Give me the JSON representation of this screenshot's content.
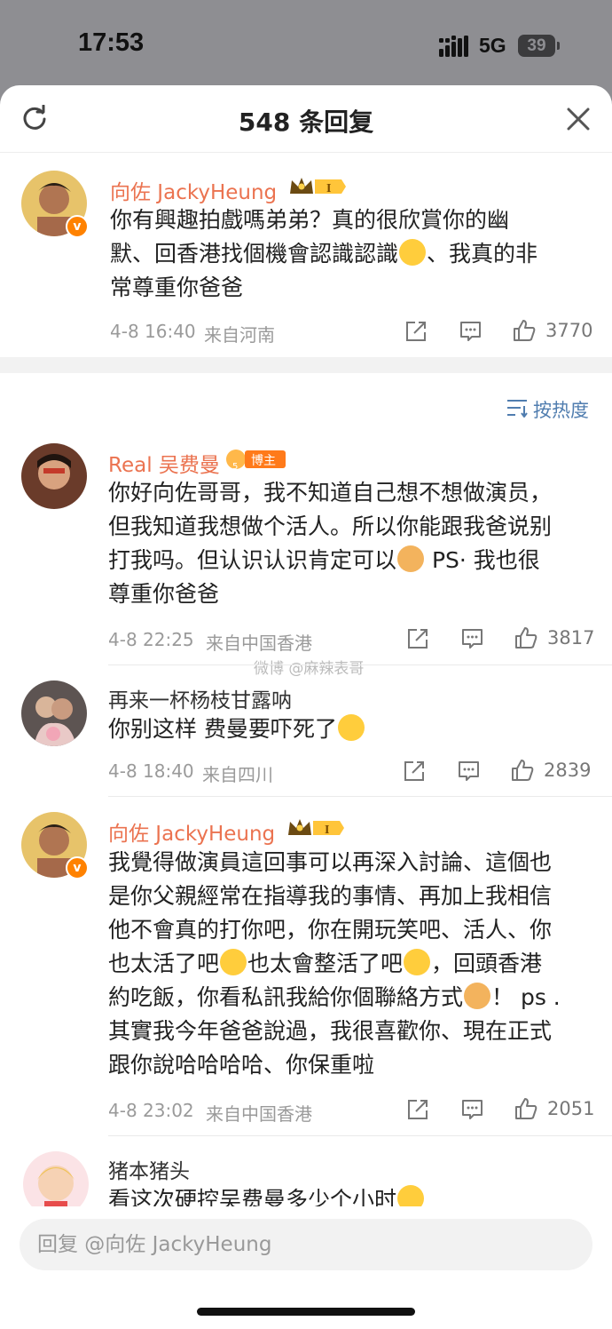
{
  "status_bar": {
    "time": "17:53",
    "network": "5G",
    "battery": "39"
  },
  "header": {
    "title": "548 条回复"
  },
  "root_comment": {
    "user": "向佐 JackyHeung",
    "badge": "I",
    "text": [
      "你有興趣拍戲嗎弟弟？真的很欣賞你的幽",
      "默、回香港找個機會認識認識",
      "、我真的非",
      "常尊重你爸爸"
    ],
    "time": "4-8 16:40",
    "location": "来自河南",
    "likes": "3770"
  },
  "sort_label": "按热度",
  "replies": [
    {
      "user": "Real 吴费曼",
      "badge": "博主",
      "level": "5",
      "text": [
        "你好向佐哥哥，我不知道自己想不想做演员，",
        "但我知道我想做个活人。所以你能跟我爸说别",
        "打我吗。但认识认识肯定可以",
        " PS· 我也很",
        "尊重你爸爸"
      ],
      "time": "4-8 22:25",
      "location": "来自中国香港",
      "likes": "3817"
    },
    {
      "user": "再来一杯杨枝甘露呐",
      "text": [
        "你别这样 费曼要吓死了"
      ],
      "time": "4-8 18:40",
      "location": "来自四川",
      "likes": "2839"
    },
    {
      "user": "向佐 JackyHeung",
      "badge": "I",
      "text": [
        "我覺得做演員這回事可以再深入討論、這個也",
        "是你父親經常在指導我的事情、再加上我相信",
        "他不會真的打你吧，你在開玩笑吧、活人、你",
        "也太活了吧",
        "也太會整活了吧",
        "，回頭香港",
        "約吃飯，你看私訊我給你個聯絡方式",
        "！ ps .",
        "其實我今年爸爸說過，我很喜歡你、現在正式",
        "跟你說哈哈哈哈、你保重啦"
      ],
      "time": "4-8 23:02",
      "location": "来自中国香港",
      "likes": "2051"
    },
    {
      "user": "猪本猪头",
      "text": [
        "看这次硬控吴费曼多少个小时"
      ]
    }
  ],
  "watermark": "微博 @麻辣表哥",
  "reply_placeholder": "回复 @向佐 JackyHeung"
}
